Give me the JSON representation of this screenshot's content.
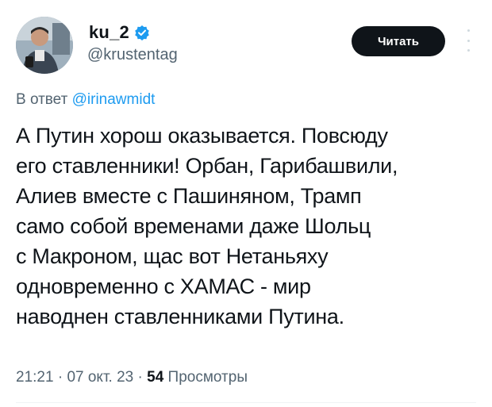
{
  "author": {
    "display_name": "ku_2",
    "handle": "@krustentag",
    "verified": true
  },
  "follow_button": {
    "label": "Читать"
  },
  "reply": {
    "prefix": "В ответ",
    "mention": "@irinawmidt"
  },
  "tweet": {
    "lines": [
      "А Путин хорош оказывается. Повсюду",
      "его ставленники! Орбан, Гарибашвили,",
      "Алиев вместе с Пашиняном, Трамп",
      "само собой временами даже Шольц",
      "с Макроном, щас вот Нетаньяху",
      "одновременно с ХАМАС - мир",
      "наводнен ставленниками Путина."
    ]
  },
  "meta": {
    "time": "21:21",
    "separator": "·",
    "date": "07 окт. 23",
    "views_count": "54",
    "views_label": "Просмотры"
  },
  "colors": {
    "accent": "#1d9bf0",
    "text": "#0f1419",
    "secondary": "#536471",
    "button_bg": "#0f1419"
  },
  "icons": {
    "verified": "verified-badge-icon",
    "more": "more-options-icon"
  }
}
